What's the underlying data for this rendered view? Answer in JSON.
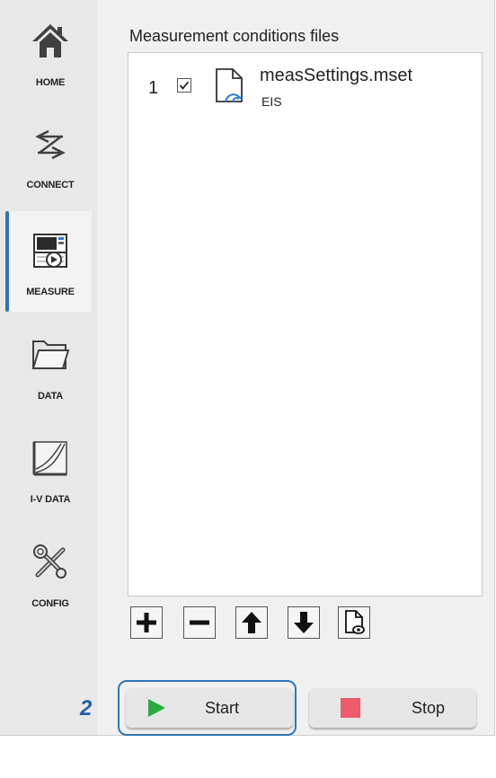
{
  "sidebar": {
    "items": [
      {
        "label": "HOME",
        "icon": "home-icon",
        "active": false
      },
      {
        "label": "CONNECT",
        "icon": "connect-icon",
        "active": false
      },
      {
        "label": "MEASURE",
        "icon": "measure-icon",
        "active": true
      },
      {
        "label": "DATA",
        "icon": "folder-icon",
        "active": false
      },
      {
        "label": "I-V DATA",
        "icon": "iv-curve-icon",
        "active": false
      },
      {
        "label": "CONFIG",
        "icon": "tools-icon",
        "active": false
      }
    ]
  },
  "main": {
    "section_title": "Measurement conditions files",
    "files": [
      {
        "index": "1",
        "checked": true,
        "name": "measSettings.mset",
        "type": "EIS",
        "icon": "settings-file-icon"
      }
    ],
    "toolbar": [
      {
        "icon": "add-icon"
      },
      {
        "icon": "remove-icon"
      },
      {
        "icon": "arrow-up-icon"
      },
      {
        "icon": "arrow-down-icon"
      },
      {
        "icon": "preview-file-icon"
      }
    ]
  },
  "actions": {
    "start_label": "Start",
    "stop_label": "Stop",
    "start_color": "#2bab3f",
    "stop_color": "#ef5b6b"
  },
  "annotation": {
    "step_number": "2",
    "highlight_color": "#2e75b6"
  }
}
